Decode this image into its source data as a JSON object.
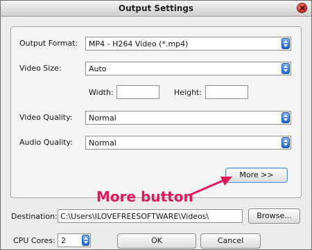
{
  "window": {
    "title": "Output Settings"
  },
  "output_format": {
    "label": "Output Format:",
    "value": "MP4 - H264 Video (*.mp4)"
  },
  "video_size": {
    "label": "Video Size:",
    "value": "Auto",
    "width_label": "Width:",
    "width_value": "",
    "height_label": "Height:",
    "height_value": ""
  },
  "video_quality": {
    "label": "Video Quality:",
    "value": "Normal"
  },
  "audio_quality": {
    "label": "Audio Quality:",
    "value": "Normal"
  },
  "more_button": {
    "label": "More >>"
  },
  "annotation": {
    "text": "More button",
    "color": "#e2185a"
  },
  "destination": {
    "label": "Destination:",
    "value": "C:\\Users\\ILOVEFREESOFTWARE\\Videos\\",
    "browse_label": "Browse..."
  },
  "cpu_cores": {
    "label": "CPU Cores:",
    "value": "2"
  },
  "ok_button": {
    "label": "OK"
  },
  "cancel_button": {
    "label": "Cancel"
  }
}
